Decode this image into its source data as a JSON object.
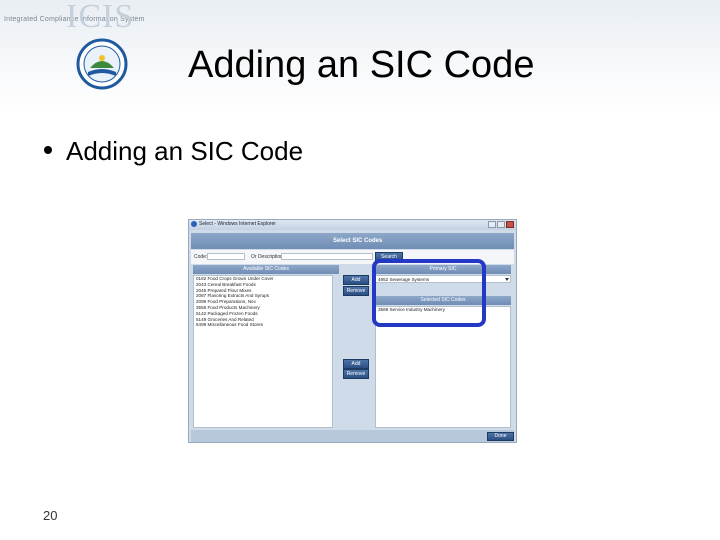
{
  "banner": {
    "tagline": "Integrated Compliance Information System",
    "logo_text": "ICIS"
  },
  "slide": {
    "title": "Adding an SIC Code",
    "bullets": [
      "Adding an SIC Code"
    ],
    "page_number": "20"
  },
  "window": {
    "title": "Select - Windows Internet Explorer",
    "heading": "Select SIC Codes",
    "search": {
      "code_label": "Code:",
      "code_value": "",
      "description_label": "Or Description:",
      "description_value": "",
      "search_button": "Search"
    },
    "available": {
      "header": "Available SIC Codes",
      "items": [
        "0182 Food Crops Grown Under Cover",
        "2043 Cereal Breakfast Foods",
        "2045 Prepared Flour Mixes",
        "2087 Flavoring Extracts And Syrups",
        "2099 Food Preparations, Nec",
        "3556 Food Products Machinery",
        "5142 Packaged Frozen Foods",
        "5149 Groceries And Related",
        "5499 Miscellaneous Food Stores"
      ],
      "add_button": "Add",
      "remove_button": "Remove"
    },
    "primary": {
      "header": "Primary SIC",
      "selected_value": "4952 Sewerage Systems",
      "add_button": "Add",
      "remove_button": "Remove"
    },
    "selected": {
      "header": "Selected SIC Codes",
      "items": [
        "3589 Service Industry Machinery"
      ]
    },
    "done_button": "Done"
  },
  "colors": {
    "highlight": "#2339c6",
    "header_blue": "#7f9abf",
    "button_blue": "#2c4f82"
  }
}
